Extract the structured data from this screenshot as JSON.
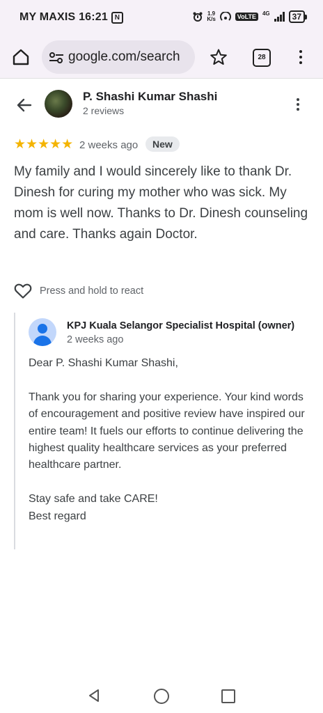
{
  "status_bar": {
    "carrier_time": "MY MAXIS 16:21",
    "nfc_glyph": "N",
    "speed": "1.9",
    "speed_unit": "K/s",
    "volte": "VoLTE",
    "network": "4G",
    "battery": "37"
  },
  "browser": {
    "url": "google.com/search",
    "tab_count": "28"
  },
  "review": {
    "reviewer_name": "P. Shashi Kumar Shashi",
    "reviewer_reviews": "2 reviews",
    "rating": 5,
    "stars": "★★★★★",
    "date": "2 weeks ago",
    "badge": "New",
    "text": "My family and I would sincerely like to thank Dr. Dinesh for curing my mother who was sick. My mom is well now. Thanks to Dr. Dinesh counseling and care. Thanks again Doctor.",
    "react_label": "Press and hold to react"
  },
  "owner_reply": {
    "name": "KPJ Kuala Selangor Specialist Hospital (owner)",
    "date": "2 weeks ago",
    "text": "Dear P. Shashi Kumar Shashi,\n\nThank you for sharing your experience. Your kind words of encouragement and positive review have inspired our entire team! It fuels our efforts to continue delivering the highest quality healthcare services as your preferred healthcare partner.\n\nStay safe and take CARE!\nBest regard"
  },
  "colors": {
    "star": "#f4b400",
    "accent": "#1a73e8",
    "chrome_bg": "#f6f1f8"
  },
  "icons": [
    "home-icon",
    "tune-icon",
    "star-outline-icon",
    "tab-switcher-icon",
    "more-vert-icon",
    "arrow-back-icon",
    "heart-outline-icon",
    "nav-back-icon",
    "nav-home-icon",
    "nav-recents-icon"
  ]
}
